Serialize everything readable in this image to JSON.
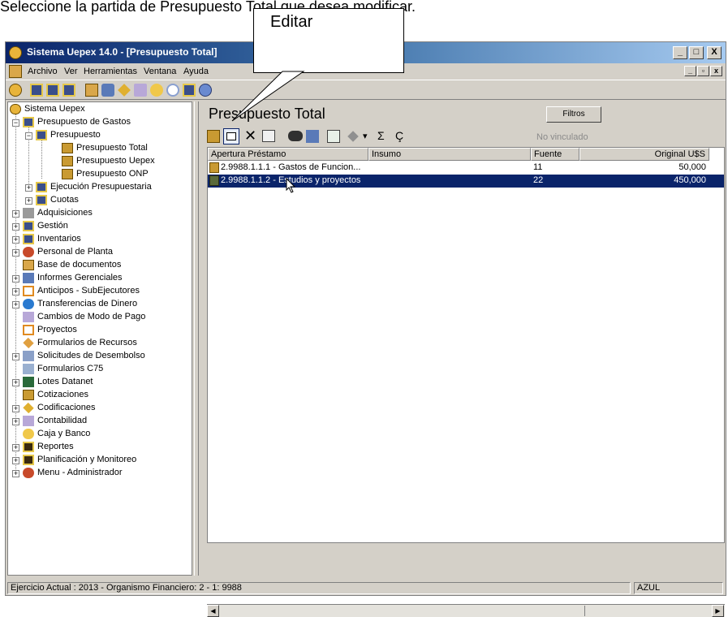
{
  "instruction": "Seleccione la partida de Presupuesto Total que desea modificar.",
  "callout": {
    "label": "Editar"
  },
  "window": {
    "title": "Sistema Uepex 14.0 - [Presupuesto Total]",
    "caption_buttons": [
      "_",
      "□",
      "X"
    ],
    "mdi_buttons": [
      "_",
      "▫",
      "x"
    ]
  },
  "menu": [
    "Archivo",
    "Ver",
    "Herramientas",
    "Ventana",
    "Ayuda"
  ],
  "tree": {
    "root": "Sistema Uepex",
    "items": [
      "Presupuesto de Gastos",
      "Presupuesto",
      "Presupuesto Total",
      "Presupuesto Uepex",
      "Presupuesto ONP",
      "Ejecución Presupuestaria",
      "Cuotas",
      "Adquisiciones",
      "Gestión",
      "Inventarios",
      "Personal de Planta",
      "Base de documentos",
      "Informes Gerenciales",
      "Anticipos - SubEjecutores",
      "Transferencias de Dinero",
      "Cambios de Modo de Pago",
      "Proyectos",
      "Formularios de Recursos",
      "Solicitudes de Desembolso",
      "Formularios C75",
      "Lotes Datanet",
      "Cotizaciones",
      "Codificaciones",
      "Contabilidad",
      "Caja y Banco",
      "Reportes",
      "Planificación y Monitoreo",
      "Menu - Administrador"
    ]
  },
  "panel": {
    "title": "Presupuesto Total",
    "filter_button": "Filtros",
    "link_status": "No vinculado",
    "toolbar_symbols": {
      "sum": "Σ",
      "currency": "Ç",
      "dropdown": "▾"
    },
    "columns": [
      "Apertura Préstamo",
      "Insumo",
      "Fuente",
      "Original U$S"
    ],
    "rows": [
      {
        "apertura": "2.9988.1.1.1  -  Gastos de Funcion...",
        "insumo": "",
        "fuente": "11",
        "original": "50,000"
      },
      {
        "apertura": "2.9988.1.1.2  -  Estudios y proyectos",
        "insumo": "",
        "fuente": "22",
        "original": "450,000"
      }
    ]
  },
  "status": {
    "left": "Ejercicio Actual : 2013 - Organismo Financiero: 2 - 1: 9988",
    "right": "AZUL"
  },
  "colors": {
    "title_gradient_start": "#0a246a",
    "selection": "#0a246a",
    "chrome": "#d4d0c8"
  }
}
